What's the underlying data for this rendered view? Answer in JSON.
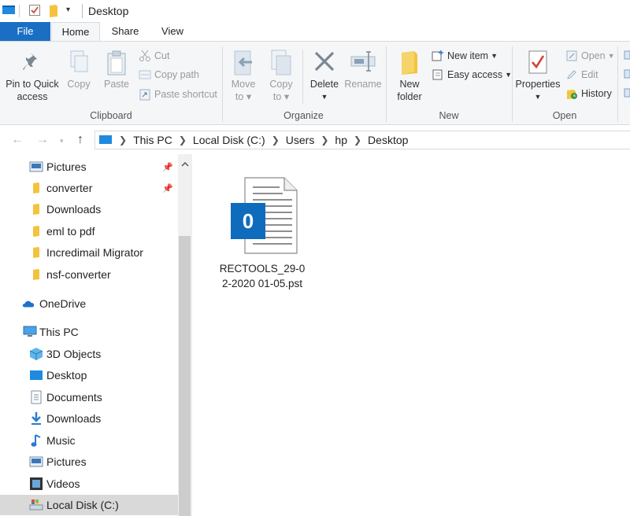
{
  "window": {
    "title": "Desktop"
  },
  "tabs": {
    "file": "File",
    "home": "Home",
    "share": "Share",
    "view": "View"
  },
  "ribbon": {
    "clipboard": {
      "label": "Clipboard",
      "pin_line1": "Pin to Quick",
      "pin_line2": "access",
      "copy": "Copy",
      "paste": "Paste",
      "cut": "Cut",
      "copy_path": "Copy path",
      "paste_shortcut": "Paste shortcut"
    },
    "organize": {
      "label": "Organize",
      "move_line1": "Move",
      "move_line2": "to",
      "copy_line1": "Copy",
      "copy_line2": "to",
      "delete": "Delete",
      "rename": "Rename"
    },
    "new": {
      "label": "New",
      "new_item": "New item",
      "easy_access": "Easy access",
      "folder_line1": "New",
      "folder_line2": "folder"
    },
    "open": {
      "label": "Open",
      "properties": "Properties",
      "open": "Open",
      "edit": "Edit",
      "history": "History"
    }
  },
  "address": {
    "crumbs": [
      "This PC",
      "Local Disk (C:)",
      "Users",
      "hp",
      "Desktop"
    ]
  },
  "nav": {
    "quick": [
      {
        "label": "Pictures",
        "pinned": true
      },
      {
        "label": "converter",
        "pinned": true
      },
      {
        "label": "Downloads"
      },
      {
        "label": "eml to pdf"
      },
      {
        "label": "Incredimail Migrator"
      },
      {
        "label": "nsf-converter"
      }
    ],
    "onedrive": "OneDrive",
    "thispc": "This PC",
    "pc_items": [
      "3D Objects",
      "Desktop",
      "Documents",
      "Downloads",
      "Music",
      "Pictures",
      "Videos",
      "Local Disk (C:)"
    ],
    "selected": "Local Disk (C:)"
  },
  "content": {
    "file_line1": "RECTOOLS_29-0",
    "file_line2": "2-2020 01-05.pst"
  },
  "colors": {
    "accent": "#1a6fc5",
    "folder": "#f3c33d",
    "outlook_blue": "#0f6cbd"
  }
}
